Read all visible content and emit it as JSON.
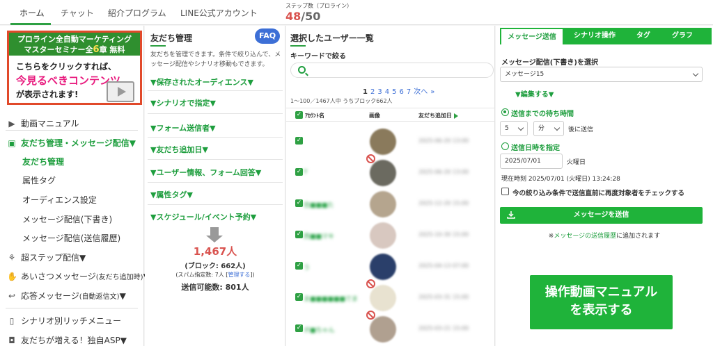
{
  "nav": {
    "tabs": [
      "ホーム",
      "チャット",
      "紹介プログラム",
      "LINE公式アカウント"
    ],
    "step_label": "ステップ数（プロライン）",
    "step_current": "48",
    "step_total": "/50"
  },
  "banner": {
    "line1": "プロライン全自動マーケティング",
    "line2a": "マスターセミナー全",
    "line2b": "6",
    "line2c": "章 無料",
    "line3": "こちらをクリックすれば、",
    "line4": "今見るべきコンテンツ",
    "line5": "が表示されます!"
  },
  "sidebar": {
    "items": [
      {
        "label": "動画マニュアル",
        "icon": "video-icon"
      },
      {
        "label": "友だち管理・メッセージ配信▼",
        "icon": "contact-card-icon"
      },
      {
        "label": "友だち管理"
      },
      {
        "label": "属性タグ"
      },
      {
        "label": "オーディエンス設定"
      },
      {
        "label": "メッセージ配信(下書き)"
      },
      {
        "label": "メッセージ配信(送信履歴)"
      },
      {
        "label": "超ステップ配信▼",
        "icon": "step-tree-icon"
      },
      {
        "label": "あいさつメッセージ",
        "small": "(友だち追加時)",
        "tail": "▼",
        "icon": "wave-hand-icon"
      },
      {
        "label": "応答メッセージ",
        "small": "(自動返信文)",
        "tail": "▼",
        "icon": "reply-icon"
      },
      {
        "label": "シナリオ別リッチメニュー",
        "icon": "phone-icon"
      },
      {
        "label": "友だちが増える！独自ASP▼",
        "icon": "chat-bubble-icon"
      }
    ]
  },
  "friends": {
    "title": "友だち管理",
    "faq": "FAQ",
    "desc": "友だちを管理できます。条件で絞り込んで、メッセージ配信やシナリオ移動もできます。",
    "sections": [
      "▼保存されたオーディエンス▼",
      "▼シナリオで指定▼",
      "▼フォーム送信者▼",
      "▼友だち追加日▼",
      "▼ユーザー情報、フォーム回答▼",
      "▼属性タグ▼",
      "▼スケジュール/イベント予約▼"
    ],
    "count": "1,467人",
    "block": "(ブロック: 662人)",
    "spam_prefix": "(スパム指定数: 7人 [",
    "spam_link": "管理する",
    "spam_suffix": "])",
    "sendable": "送信可能数: 801人"
  },
  "users": {
    "title": "選択したユーザー一覧",
    "keyword_label": "キーワードで絞る",
    "search_placeholder": "",
    "pages": [
      "1",
      "2",
      "3",
      "4",
      "5",
      "6",
      "7",
      "次へ",
      "»"
    ],
    "range": "1〜100／1467人中 うちブロック662人",
    "headers": [
      "ｱｶｳﾝﾄ名",
      "画像",
      "友だち追加日"
    ],
    "rows": [
      {
        "name": "",
        "avatar_color": "#8a7a5c",
        "date": "2025-06-20 13:00",
        "blocked": false
      },
      {
        "name": "Y",
        "avatar_color": "#6b6a60",
        "date": "2025-06-20 13:00",
        "blocked": true
      },
      {
        "name": "信■■■た",
        "avatar_color": "#b5a58e",
        "date": "2025-12-20 15:00",
        "blocked": false
      },
      {
        "name": "西■■マキ",
        "avatar_color": "#d8c8c0",
        "date": "2025-10-30 15:00",
        "blocked": false
      },
      {
        "name": "う",
        "avatar_color": "#2a3f6a",
        "date": "2025-04-13 07:00",
        "blocked": false
      },
      {
        "name": "ま■■■■■■でま",
        "avatar_color": "#e8e2d0",
        "date": "2025-03-31 15:00",
        "blocked": true
      },
      {
        "name": "ボ■ちゃん",
        "avatar_color": "#b0a090",
        "date": "2025-03-21 15:00",
        "blocked": true
      }
    ]
  },
  "message": {
    "tabs": [
      "メッセージ送信",
      "シナリオ操作",
      "タグ",
      "グラフ"
    ],
    "select_label": "メッセージ配信(下書き)を選択",
    "selected_message": "メッセージ15",
    "edit": "▼編集する▼",
    "wait_label": "送信までの待ち時間",
    "wait_value": "5",
    "wait_unit": "分",
    "wait_suffix": "後に送信",
    "datetime_label": "送信日時を指定",
    "date_value": "2025/07/01",
    "weekday": "火曜日",
    "now": "現在時刻 2025/07/01 (火曜日) 13:24:28",
    "recheck": "今の絞り込み条件で送信直前に再度対象者をチェックする",
    "send": "メッセージを送信",
    "note_prefix": "※",
    "note_link": "メッセージの送信履歴",
    "note_suffix": "に追加されます",
    "manual_line1": "操作動画マニュアル",
    "manual_line2": "を表示する"
  },
  "colors": {
    "accent": "#1fb33a",
    "danger": "#d9534f",
    "link": "#3d6fd6"
  }
}
